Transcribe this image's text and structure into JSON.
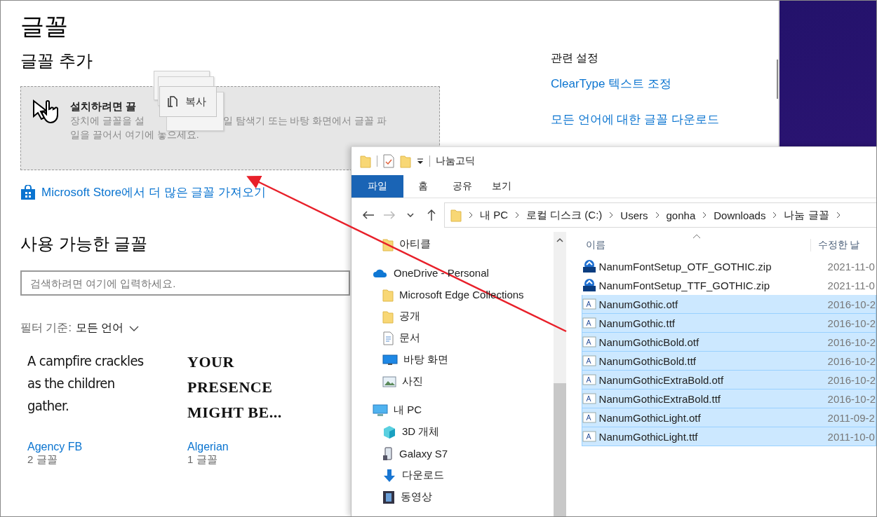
{
  "settings": {
    "title": "글꼴",
    "add": {
      "heading": "글꼴 추가",
      "drop_title": "설치하려면 끌",
      "drop_text": [
        "장치에 글꼴을 설",
        "일 탐색기 또는 바탕 화면에서 글꼴 파",
        "일을 끌어서 여기에 놓으세요."
      ],
      "drag_badge": "복사"
    },
    "store_link": "Microsoft Store에서 더 많은 글꼴 가져오기",
    "available": {
      "heading": "사용 가능한 글꼴",
      "search": {
        "placeholder": "검색하려면 여기에 입력하세요."
      },
      "filter_label": "필터 기준:",
      "filter_value": "모든 언어"
    },
    "fonts": [
      {
        "kind": "condensed",
        "sample": "A campfire crackles\nas the children\ngather.",
        "name": "Agency FB",
        "count": "2 글꼴"
      },
      {
        "kind": "decorative",
        "sample": "YOUR\nPRESENCE\nMIGHT BE...",
        "name": "Algerian",
        "count": "1 글꼴"
      }
    ],
    "related": {
      "heading": "관련 설정",
      "links": [
        "ClearType 텍스트 조정",
        "모든 언어에 대한 글꼴 다운로드"
      ]
    }
  },
  "explorer": {
    "title": "나눔고딕",
    "ribbon_tabs": [
      {
        "label": "파일",
        "selected": true
      },
      {
        "label": "홈",
        "selected": false
      },
      {
        "label": "공유",
        "selected": false
      },
      {
        "label": "보기",
        "selected": false
      }
    ],
    "nav_buttons": [
      {
        "kind": "back",
        "disabled": false
      },
      {
        "kind": "forward",
        "disabled": true
      },
      {
        "kind": "recent",
        "disabled": false
      },
      {
        "kind": "up",
        "disabled": false
      }
    ],
    "breadcrumbs": [
      "내 PC",
      "로컬 디스크 (C:)",
      "Users",
      "gonha",
      "Downloads",
      "나눔 글꼴"
    ],
    "nav_tree": [
      {
        "children": [
          {
            "label": "아티클",
            "kind": "folder"
          }
        ]
      },
      {
        "label": "OneDrive - Personal",
        "kind": "cloud",
        "children": [
          {
            "label": "Microsoft Edge Collections",
            "kind": "folder"
          },
          {
            "label": "공개",
            "kind": "folder"
          },
          {
            "label": "문서",
            "kind": "document"
          },
          {
            "label": "바탕 화면",
            "kind": "desktop"
          },
          {
            "label": "사진",
            "kind": "pictures"
          }
        ]
      },
      {
        "label": "내 PC",
        "kind": "pc",
        "children": [
          {
            "label": "3D 개체",
            "kind": "cube"
          },
          {
            "label": "Galaxy S7",
            "kind": "phone"
          },
          {
            "label": "다운로드",
            "kind": "download"
          },
          {
            "label": "동영상",
            "kind": "video"
          }
        ]
      }
    ],
    "columns": [
      "이름",
      "수정한 날"
    ],
    "files": [
      {
        "name": "NanumFontSetup_OTF_GOTHIC.zip",
        "date": "2021-11-0",
        "kind": "zip",
        "selected": false
      },
      {
        "name": "NanumFontSetup_TTF_GOTHIC.zip",
        "date": "2021-11-0",
        "kind": "zip",
        "selected": false
      },
      {
        "name": "NanumGothic.otf",
        "date": "2016-10-2",
        "kind": "font",
        "selected": true
      },
      {
        "name": "NanumGothic.ttf",
        "date": "2016-10-2",
        "kind": "font",
        "selected": true
      },
      {
        "name": "NanumGothicBold.otf",
        "date": "2016-10-2",
        "kind": "font",
        "selected": true
      },
      {
        "name": "NanumGothicBold.ttf",
        "date": "2016-10-2",
        "kind": "font",
        "selected": true
      },
      {
        "name": "NanumGothicExtraBold.otf",
        "date": "2016-10-2",
        "kind": "font",
        "selected": true
      },
      {
        "name": "NanumGothicExtraBold.ttf",
        "date": "2016-10-2",
        "kind": "font",
        "selected": true
      },
      {
        "name": "NanumGothicLight.otf",
        "date": "2011-09-2",
        "kind": "font",
        "selected": true
      },
      {
        "name": "NanumGothicLight.ttf",
        "date": "2011-10-0",
        "kind": "font",
        "selected": true
      }
    ]
  }
}
